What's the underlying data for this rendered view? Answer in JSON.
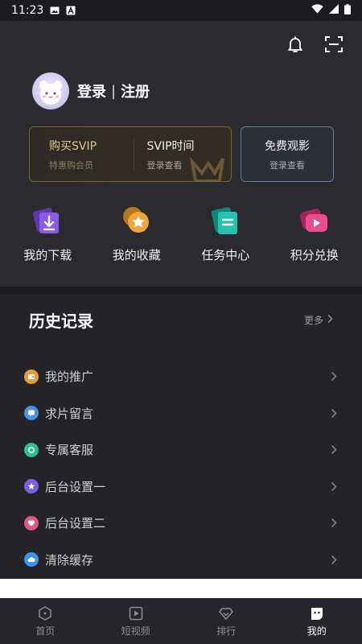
{
  "status_bar": {
    "time": "11:23"
  },
  "profile": {
    "login": "登录",
    "separator": "|",
    "register": "注册"
  },
  "vip_card": {
    "buy": {
      "title": "购买SVIP",
      "subtitle": "特惠购会员"
    },
    "time": {
      "title": "SVIP时间",
      "subtitle": "登录查看"
    }
  },
  "free_card": {
    "title": "免费观影",
    "subtitle": "登录查看"
  },
  "quick_actions": [
    {
      "label": "我的下载",
      "icon": "download-icon",
      "color": "#8a4fe0"
    },
    {
      "label": "我的收藏",
      "icon": "star-icon",
      "color": "#e89a2a"
    },
    {
      "label": "任务中心",
      "icon": "task-icon",
      "color": "#1fb3a5"
    },
    {
      "label": "积分兑换",
      "icon": "exchange-icon",
      "color": "#e0407f"
    }
  ],
  "history": {
    "title": "历史记录",
    "more": "更多"
  },
  "menu": [
    {
      "label": "我的推广",
      "icon": "promote-icon",
      "color": "#e89a3a"
    },
    {
      "label": "求片留言",
      "icon": "message-icon",
      "color": "#4b8fe6"
    },
    {
      "label": "专属客服",
      "icon": "service-icon",
      "color": "#2fbf8f"
    },
    {
      "label": "后台设置一",
      "icon": "star-icon",
      "color": "#7a5de0"
    },
    {
      "label": "后台设置二",
      "icon": "heart-icon",
      "color": "#e0577f"
    },
    {
      "label": "清除缓存",
      "icon": "cloud-icon",
      "color": "#3d93e6"
    }
  ],
  "bottom_nav": [
    {
      "label": "首页",
      "icon": "home-icon"
    },
    {
      "label": "短视频",
      "icon": "play-icon"
    },
    {
      "label": "排行",
      "icon": "diamond-icon"
    },
    {
      "label": "我的",
      "icon": "mine-icon",
      "active": true
    }
  ]
}
